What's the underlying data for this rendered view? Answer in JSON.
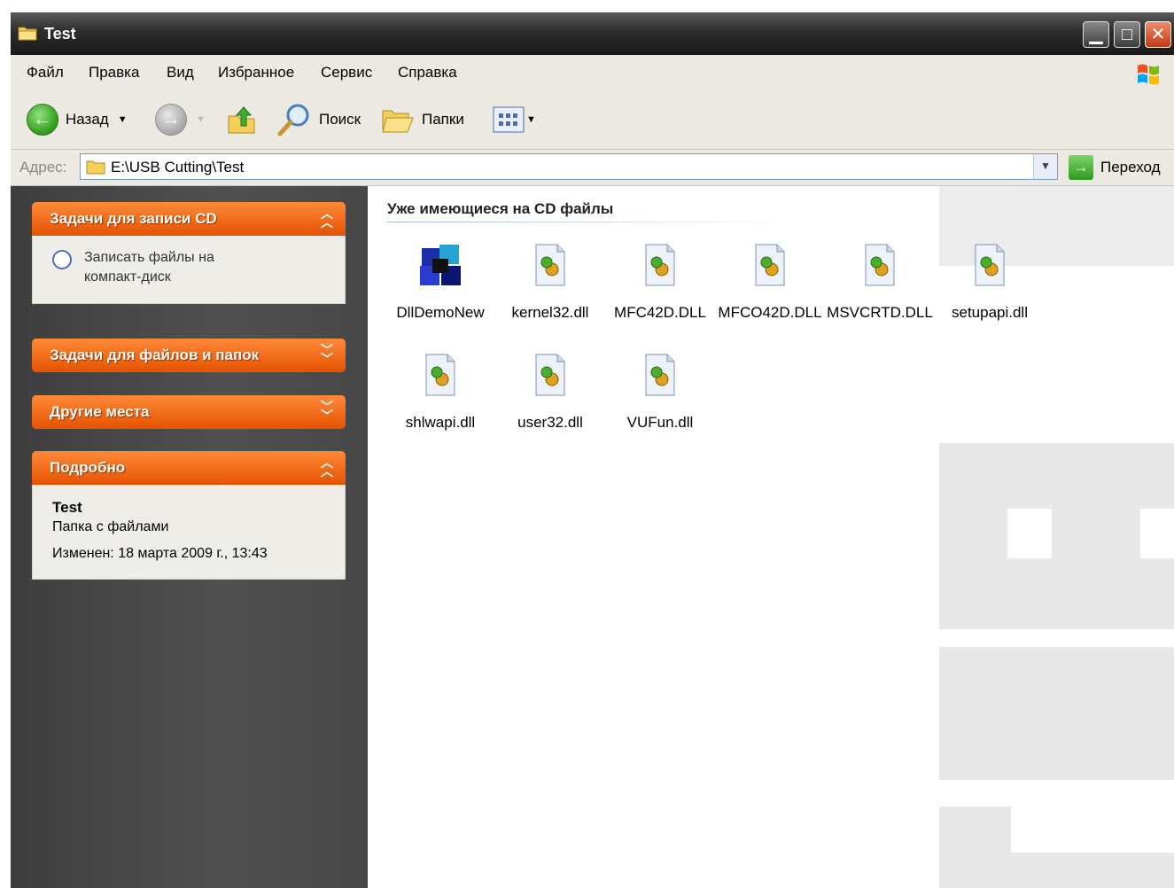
{
  "window": {
    "title": "Test"
  },
  "menu": [
    {
      "label": "Файл"
    },
    {
      "label": "Правка"
    },
    {
      "label": "Вид"
    },
    {
      "label": "Избранное"
    },
    {
      "label": "Сервис"
    },
    {
      "label": "Справка"
    }
  ],
  "toolbar": {
    "back_label": "Назад",
    "search_label": "Поиск",
    "folders_label": "Папки"
  },
  "address": {
    "label": "Адрес:",
    "path": "E:\\USB Cutting\\Test",
    "go_label": "Переход"
  },
  "tasks": {
    "cd_title": "Задачи для записи CD",
    "cd_item": "Записать файлы на компакт-диск",
    "files_title": "Задачи для файлов и папок",
    "places_title": "Другие места",
    "details_title": "Подробно",
    "details_name": "Test",
    "details_type": "Папка с файлами",
    "details_modified": "Изменен: 18 марта 2009 г., 13:43"
  },
  "group_title": "Уже имеющиеся на CD файлы",
  "files": [
    {
      "name": "DllDemoNew",
      "icon": "application-icon"
    },
    {
      "name": "kernel32.dll",
      "icon": "dll-file-icon"
    },
    {
      "name": "MFC42D.DLL",
      "icon": "dll-file-icon"
    },
    {
      "name": "MFCO42D.DLL",
      "icon": "dll-file-icon"
    },
    {
      "name": "MSVCRTD.DLL",
      "icon": "dll-file-icon"
    },
    {
      "name": "setupapi.dll",
      "icon": "dll-file-icon"
    },
    {
      "name": "shlwapi.dll",
      "icon": "dll-file-icon"
    },
    {
      "name": "user32.dll",
      "icon": "dll-file-icon"
    },
    {
      "name": "VUFun.dll",
      "icon": "dll-file-icon"
    }
  ],
  "colors": {
    "task_header": "#e45300",
    "left_pane": "#474747",
    "titlebar": "#2c2c2c"
  }
}
